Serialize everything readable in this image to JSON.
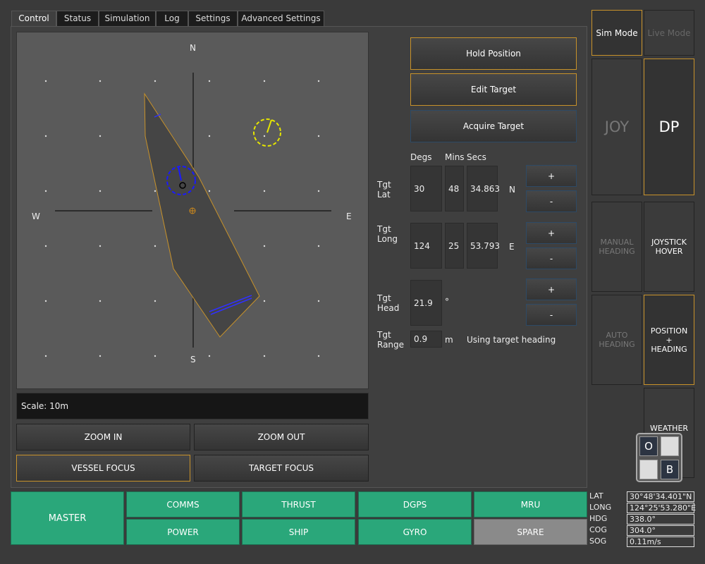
{
  "tabs": [
    "Control",
    "Status",
    "Simulation",
    "Log",
    "Settings",
    "Advanced Settings"
  ],
  "map": {
    "compass": {
      "n": "N",
      "s": "S",
      "e": "E",
      "w": "W"
    },
    "scale_text": "Scale: 10m"
  },
  "map_buttons": {
    "zoom_in": "ZOOM IN",
    "zoom_out": "ZOOM OUT",
    "vessel_focus": "VESSEL FOCUS",
    "target_focus": "TARGET FOCUS"
  },
  "actions": {
    "hold_position": "Hold Position",
    "edit_target": "Edit Target",
    "acquire_target": "Acquire Target"
  },
  "target": {
    "col_degs": "Degs",
    "col_mins": "Mins",
    "col_secs": "Secs",
    "lat_label": "Tgt\nLat",
    "lat_degs": "30",
    "lat_mins": "48",
    "lat_secs": "34.863",
    "lat_hemi": "N",
    "long_label": "Tgt\nLong",
    "long_degs": "124",
    "long_mins": "25",
    "long_secs": "53.793",
    "long_hemi": "E",
    "head_label": "Tgt\nHead",
    "head_value": "21.9",
    "head_unit": "°",
    "range_label": "Tgt\nRange",
    "range_value": "0.9",
    "range_unit": "m",
    "range_note": "Using target heading",
    "plus": "+",
    "minus": "-"
  },
  "modes": {
    "sim_mode": "Sim Mode",
    "live_mode": "Live Mode",
    "joy": "JOY",
    "dp": "DP",
    "manual_heading": "MANUAL\nHEADING",
    "joystick_hover": "JOYSTICK\nHOVER",
    "auto_heading": "AUTO\nHEADING",
    "position_heading": "POSITION\n+\nHEADING",
    "weather_vane": "WEATHER\nVANE"
  },
  "ob_widget": {
    "o": "O",
    "b": "B"
  },
  "status": {
    "master": "MASTER",
    "comms": "COMMS",
    "thrust": "THRUST",
    "dgps": "DGPS",
    "mru": "MRU",
    "power": "POWER",
    "ship": "SHIP",
    "gyro": "GYRO",
    "spare": "SPARE"
  },
  "readouts": [
    {
      "label": "LAT",
      "value": "30°48'34.401\"N"
    },
    {
      "label": "LONG",
      "value": "124°25'53.280\"E"
    },
    {
      "label": "HDG",
      "value": "338.0°"
    },
    {
      "label": "COG",
      "value": "304.0°"
    },
    {
      "label": "SOG",
      "value": "0.11m/s"
    }
  ],
  "colors": {
    "status_green": "#2aa77a",
    "active_border": "#c8922a",
    "vessel_outline": "#c8922a",
    "target_marker": "#e6e600",
    "vessel_marker": "#1a1aff"
  }
}
